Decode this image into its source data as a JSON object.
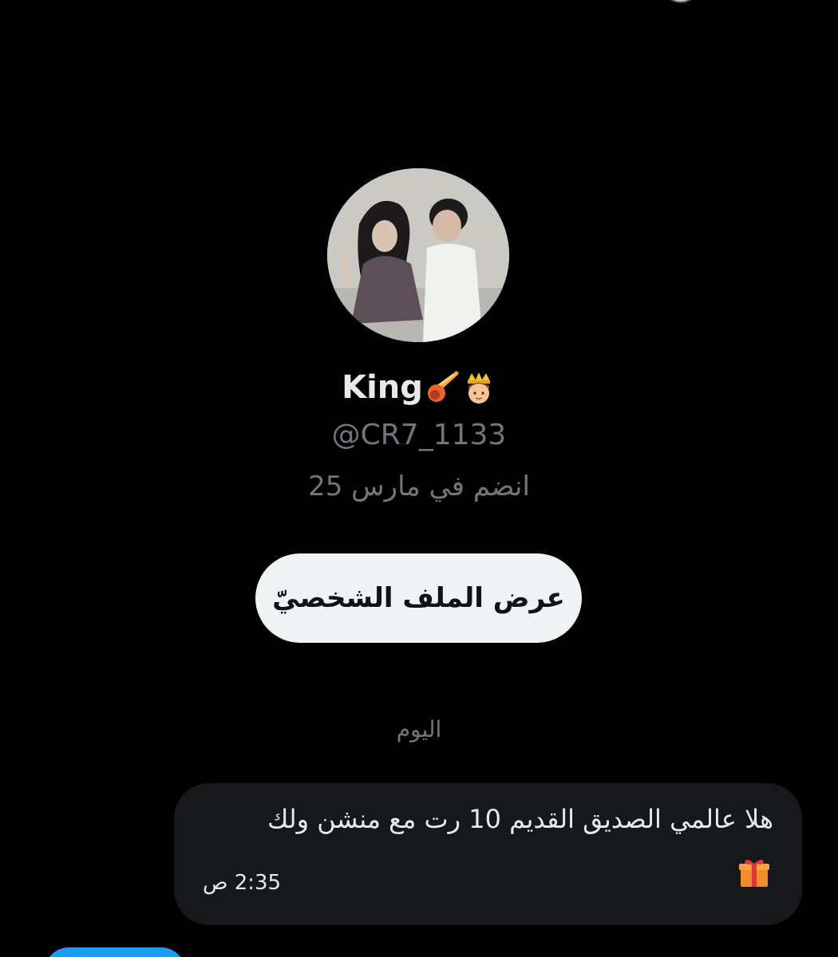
{
  "profile": {
    "display_name": "King",
    "name_emojis": [
      "comet-emoji",
      "prince-emoji"
    ],
    "handle": "@CR7_1133",
    "joined": "انضم في مارس 25",
    "view_profile_label": "عرض الملف الشخصيّ"
  },
  "conversation": {
    "day_label": "اليوم",
    "messages": [
      {
        "direction": "received",
        "text": "هلا عالمي الصديق القديم  10 رت مع منشن ولك",
        "trailing_emoji": "gift-icon",
        "time": "2:35 ص"
      }
    ]
  },
  "colors": {
    "background": "#000000",
    "primary_text": "#e7e9ea",
    "secondary_text": "#71767b",
    "button_bg": "#eff3f4",
    "button_text": "#0f1419",
    "received_bubble": "#16181c",
    "sent_bubble": "#1d9bf0"
  }
}
